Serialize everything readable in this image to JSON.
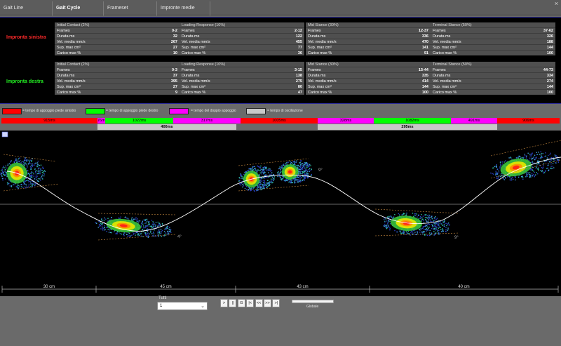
{
  "tabs": [
    {
      "label": "Gait Line",
      "active": false
    },
    {
      "label": "Gait Cycle",
      "active": true
    },
    {
      "label": "Frameset",
      "active": false
    },
    {
      "label": "Impronte medie",
      "active": false
    }
  ],
  "close_label": "×",
  "left_foot": {
    "title": "Impronta sinistra",
    "color": "#ff2a2a",
    "phases": [
      {
        "title": "Initial Contact (2%)",
        "rows": [
          [
            "Frames",
            "0-2"
          ],
          [
            "Durata ms",
            "32"
          ],
          [
            "Vel. media mm/s",
            "267"
          ],
          [
            "Sup. max cm²",
            "27"
          ],
          [
            "Carico max %",
            "10"
          ]
        ]
      },
      {
        "title": "Loading Response (10%)",
        "rows": [
          [
            "Frames",
            "2-12"
          ],
          [
            "Durata ms",
            "122"
          ],
          [
            "Vel. media mm/s",
            "455"
          ],
          [
            "Sup. max cm²",
            "77"
          ],
          [
            "Carico max %",
            "36"
          ]
        ]
      },
      {
        "title": "Mid Stance (30%)",
        "rows": [
          [
            "Frames",
            "12-37"
          ],
          [
            "Durata ms",
            "336"
          ],
          [
            "Vel. media mm/s",
            "470"
          ],
          [
            "Sup. max cm²",
            "141"
          ],
          [
            "Carico max %",
            "91"
          ]
        ]
      },
      {
        "title": "Terminal Stance (50%)",
        "rows": [
          [
            "Frames",
            "37-62"
          ],
          [
            "Durata ms",
            "326"
          ],
          [
            "Vel. media mm/s",
            "188"
          ],
          [
            "Sup. max cm²",
            "144"
          ],
          [
            "Carico max %",
            "100"
          ]
        ]
      }
    ]
  },
  "right_foot": {
    "title": "Impronta destra",
    "color": "#22ee22",
    "phases": [
      {
        "title": "Initial Contact (2%)",
        "rows": [
          [
            "Frames",
            "0-3"
          ],
          [
            "Durata ms",
            "37"
          ],
          [
            "Vel. media mm/s",
            "395"
          ],
          [
            "Sup. max cm²",
            "27"
          ],
          [
            "Carico max %",
            "9"
          ]
        ]
      },
      {
        "title": "Loading Response (10%)",
        "rows": [
          [
            "Frames",
            "3-15"
          ],
          [
            "Durata ms",
            "138"
          ],
          [
            "Vel. media mm/s",
            "275"
          ],
          [
            "Sup. max cm²",
            "80"
          ],
          [
            "Carico max %",
            "47"
          ]
        ]
      },
      {
        "title": "Mid Stance (30%)",
        "rows": [
          [
            "Frames",
            "15-44"
          ],
          [
            "Durata ms",
            "335"
          ],
          [
            "Vel. media mm/s",
            "414"
          ],
          [
            "Sup. max cm²",
            "144"
          ],
          [
            "Carico max %",
            "100"
          ]
        ]
      },
      {
        "title": "Terminal Stance (50%)",
        "rows": [
          [
            "Frames",
            "44-73"
          ],
          [
            "Durata ms",
            "334"
          ],
          [
            "Vel. media mm/s",
            "274"
          ],
          [
            "Sup. max cm²",
            "144"
          ],
          [
            "Carico max %",
            "100"
          ]
        ]
      }
    ]
  },
  "legend": [
    {
      "color": "#ff0000",
      "text": "= tempo di appoggio piede sinistro"
    },
    {
      "color": "#00ff00",
      "text": "= tempo di appoggio piede destro"
    },
    {
      "color": "#ff00ff",
      "text": "= tempo del doppio appoggio"
    },
    {
      "color": "#c8c8c8",
      "text": "= tempo di oscillazione"
    }
  ],
  "timeline_row1": [
    {
      "label": "915ms",
      "color": "#ff0000"
    },
    {
      "label": "76ms",
      "color": "#ff00ff"
    },
    {
      "label": "1022ms",
      "color": "#00ff00"
    },
    {
      "label": "317ms",
      "color": "#ff00ff"
    },
    {
      "label": "1005ms",
      "color": "#ff0000"
    },
    {
      "label": "328ms",
      "color": "#ff00ff"
    },
    {
      "label": "1082ms",
      "color": "#00ff00"
    },
    {
      "label": "491ms",
      "color": "#ff00ff"
    },
    {
      "label": "906ms",
      "color": "#ff0000"
    }
  ],
  "timeline_row2": [
    {
      "label": "400ms",
      "color": "#c8c8c8"
    },
    {
      "label": "295ms",
      "color": "#c8c8c8"
    }
  ],
  "angle_labels": [
    "9°",
    "4°",
    "9°"
  ],
  "distances": [
    "30 cm",
    "45 cm",
    "43 cm",
    "40 cm"
  ],
  "controls": {
    "steps_label": "Tutti",
    "steps_value": "1",
    "buttons": [
      ">",
      "||",
      "G",
      "|<",
      "<<",
      ">>",
      ">|"
    ],
    "global_label": "Globale"
  }
}
